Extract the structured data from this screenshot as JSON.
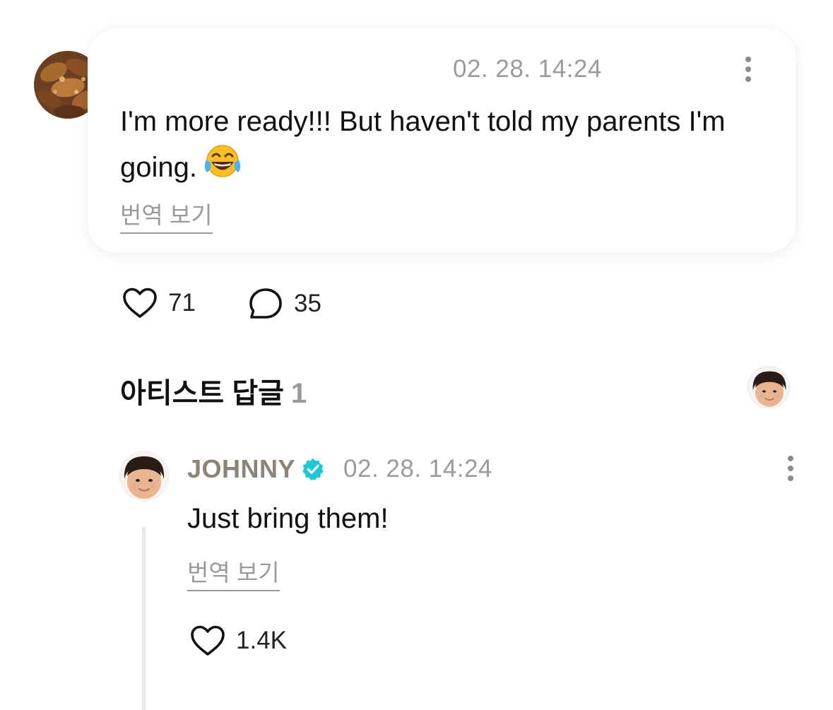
{
  "comment": {
    "timestamp": "02. 28. 14:24",
    "text": "I'm more ready!!! But haven't told my parents I'm going.",
    "emoji": "face-with-tears-of-joy",
    "translate_label": "번역 보기",
    "like_count": "71",
    "reply_count": "35"
  },
  "artist_replies": {
    "title": "아티스트 답글",
    "count": "1"
  },
  "reply": {
    "author": "JOHNNY",
    "timestamp": "02. 28. 14:24",
    "text": "Just bring them!",
    "translate_label": "번역 보기",
    "like_count": "1.4K"
  },
  "colors": {
    "muted_text": "#9b9b9b",
    "artist_name": "#8c8478",
    "verified_badge": "#1ec8d6",
    "thread_line": "#e8e8ec"
  },
  "icons": {
    "like": "heart-outline-icon",
    "reply": "speech-bubble-outline-icon",
    "more": "vertical-ellipsis-icon",
    "verified": "verified-badge-icon"
  }
}
